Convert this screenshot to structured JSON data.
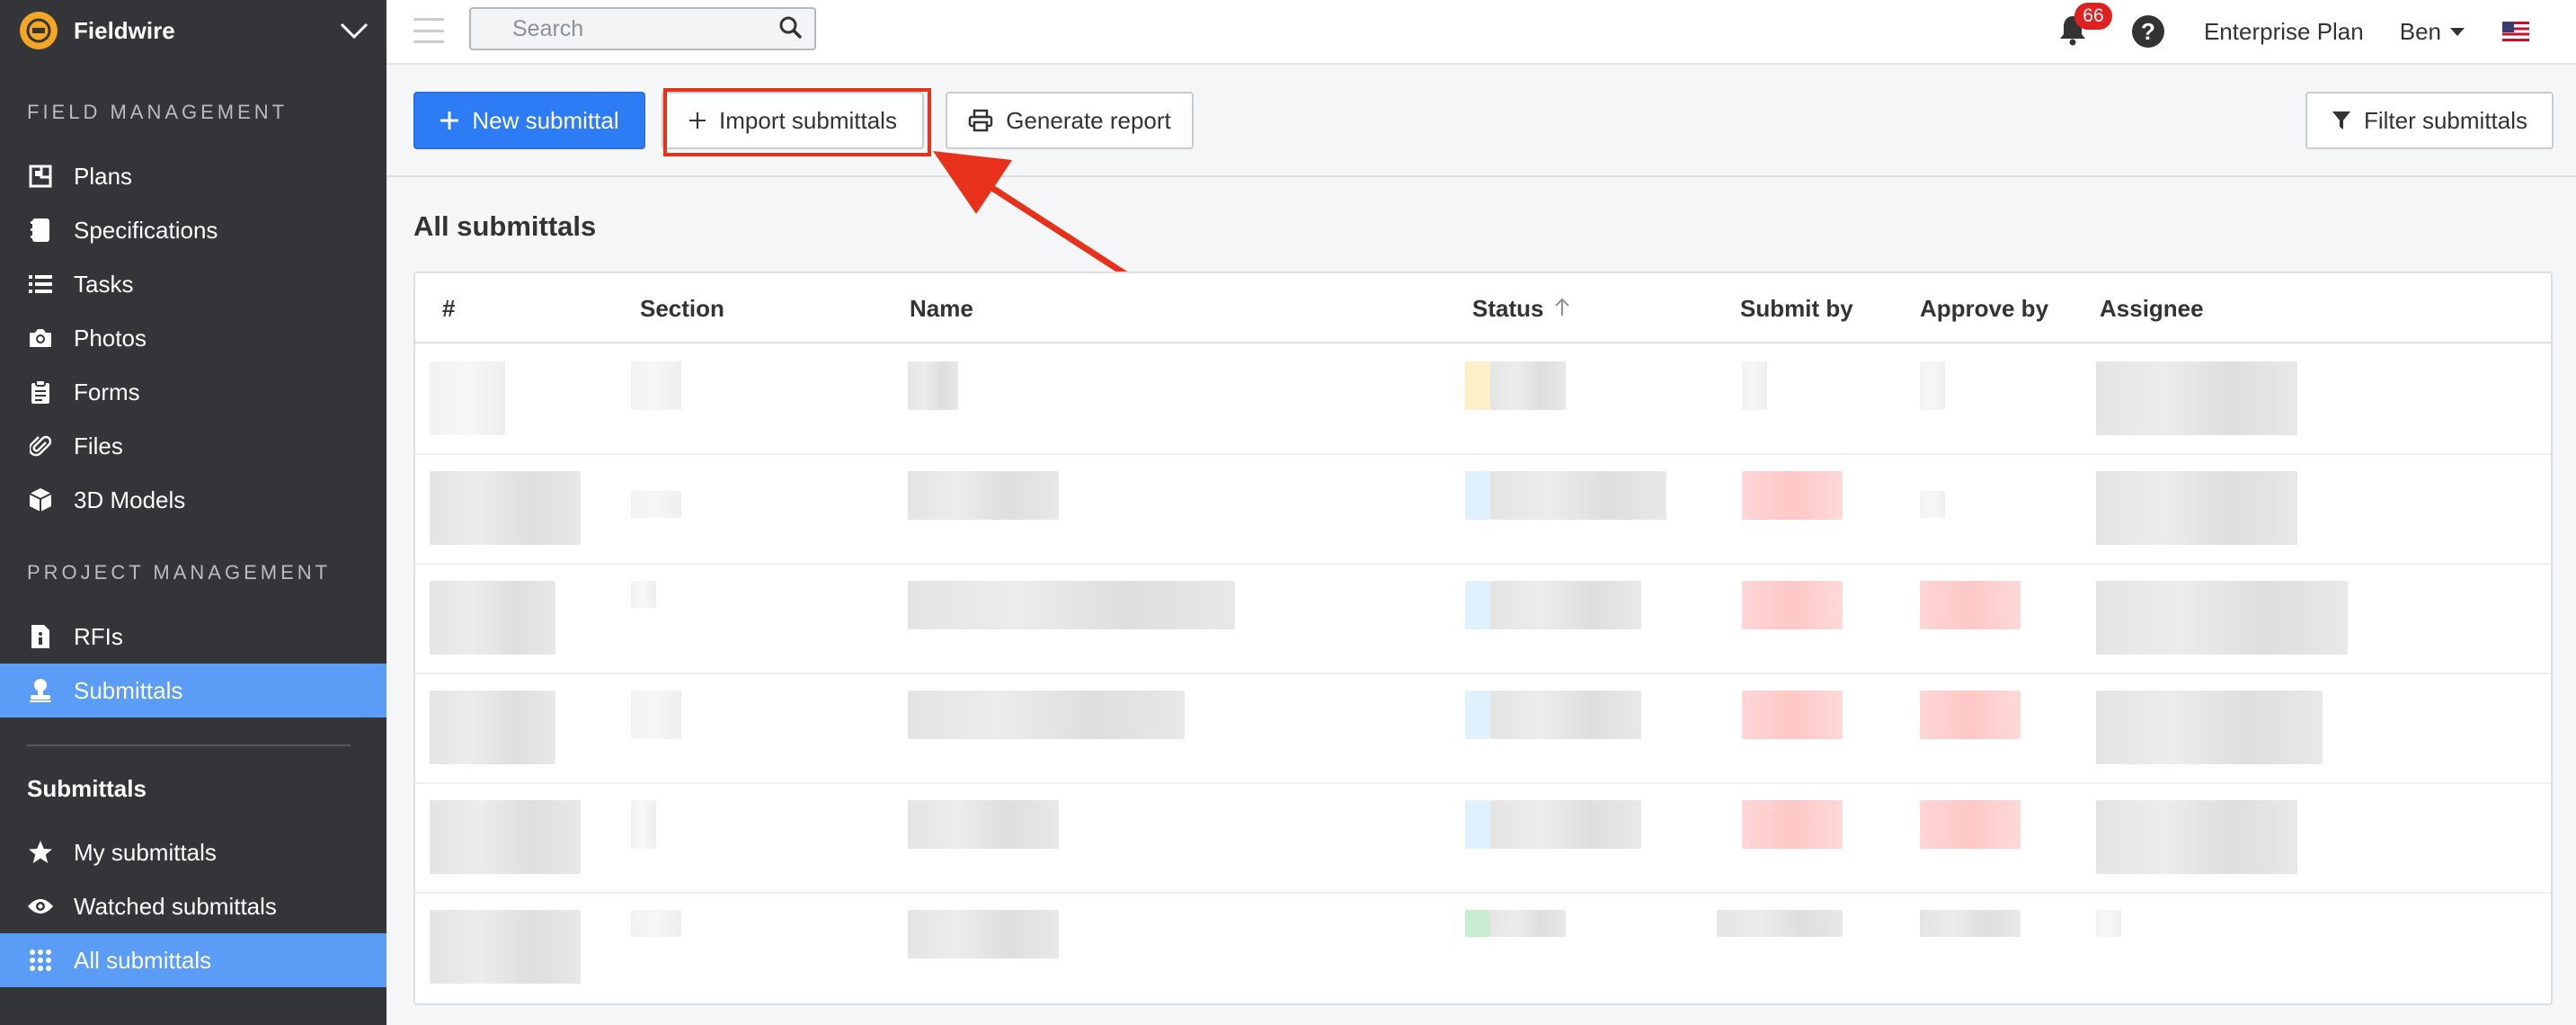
{
  "app": {
    "name": "Fieldwire"
  },
  "sidebar": {
    "field_management_title": "FIELD MANAGEMENT",
    "field_items": [
      {
        "label": "Plans",
        "icon": "plans-icon"
      },
      {
        "label": "Specifications",
        "icon": "book-icon"
      },
      {
        "label": "Tasks",
        "icon": "list-icon"
      },
      {
        "label": "Photos",
        "icon": "camera-icon"
      },
      {
        "label": "Forms",
        "icon": "clipboard-icon"
      },
      {
        "label": "Files",
        "icon": "paperclip-icon"
      },
      {
        "label": "3D Models",
        "icon": "cube-icon"
      }
    ],
    "project_management_title": "PROJECT MANAGEMENT",
    "project_items": [
      {
        "label": "RFIs",
        "icon": "document-info-icon"
      },
      {
        "label": "Submittals",
        "icon": "stamp-icon",
        "active": true
      }
    ],
    "submittals_title": "Submittals",
    "submittal_items": [
      {
        "label": "My submittals",
        "icon": "star-icon"
      },
      {
        "label": "Watched submittals",
        "icon": "eye-icon"
      },
      {
        "label": "All submittals",
        "icon": "grid-icon",
        "active": true
      }
    ]
  },
  "topbar": {
    "search_placeholder": "Search",
    "notification_count": "66",
    "plan_label": "Enterprise Plan",
    "user_name": "Ben"
  },
  "toolbar": {
    "new_label": "New submittal",
    "import_label": "Import submittals",
    "report_label": "Generate report",
    "filter_label": "Filter submittals"
  },
  "main": {
    "title": "All submittals",
    "columns": [
      "#",
      "Section",
      "Name",
      "Status",
      "Submit by",
      "Approve by",
      "Assignee"
    ]
  },
  "colors": {
    "primary": "#2d7cf6",
    "sidebar_bg": "#333538",
    "active_nav": "#5b9cf6",
    "highlight": "#e8311a",
    "badge": "#e02020"
  }
}
